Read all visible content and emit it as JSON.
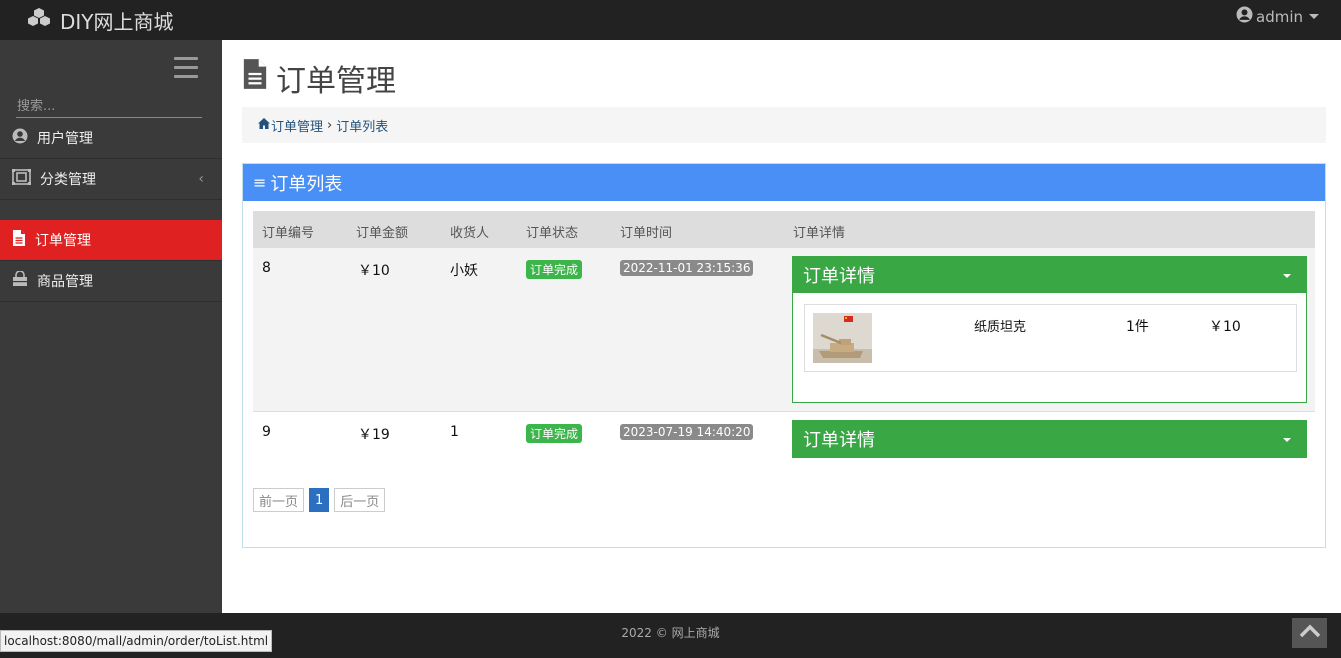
{
  "app": {
    "brand": "DIY网上商城",
    "user": "admin"
  },
  "sidebar": {
    "search_placeholder": "搜索...",
    "items": [
      {
        "label": "用户管理",
        "icon": "user-circle-icon"
      },
      {
        "label": "分类管理",
        "icon": "category-icon",
        "chevron": "‹"
      },
      {
        "label": "订单管理",
        "icon": "file-icon",
        "active": true
      },
      {
        "label": "商品管理",
        "icon": "shopping-bag-icon"
      }
    ]
  },
  "page": {
    "title": "订单管理",
    "breadcrumb": {
      "root": "订单管理",
      "sep": "›",
      "current": "订单列表"
    }
  },
  "panel": {
    "title": "订单列表",
    "columns": [
      "订单编号",
      "订单金额",
      "收货人",
      "订单状态",
      "订单时间",
      "订单详情"
    ],
    "orders": [
      {
        "id": "8",
        "amount": "￥10",
        "receiver": "小妖",
        "status": "订单完成",
        "time": "2022-11-01 23:15:36",
        "detail_title": "订单详情",
        "item": {
          "name": "纸质坦克",
          "qty": "1件",
          "price": "￥10"
        }
      },
      {
        "id": "9",
        "amount": "￥19",
        "receiver": "1",
        "status": "订单完成",
        "time": "2023-07-19 14:40:20",
        "detail_title": "订单详情"
      }
    ]
  },
  "pagination": {
    "prev": "前一页",
    "current": "1",
    "next": "后一页"
  },
  "footer": {
    "copyright": "2022 © 网上商城"
  },
  "status_bar": {
    "url": "localhost:8080/mall/admin/order/toList.html"
  },
  "colors": {
    "accent_red": "#e02121",
    "panel_blue": "#4a8ff5",
    "detail_green": "#3aa745",
    "badge_green": "#3cb54a"
  }
}
